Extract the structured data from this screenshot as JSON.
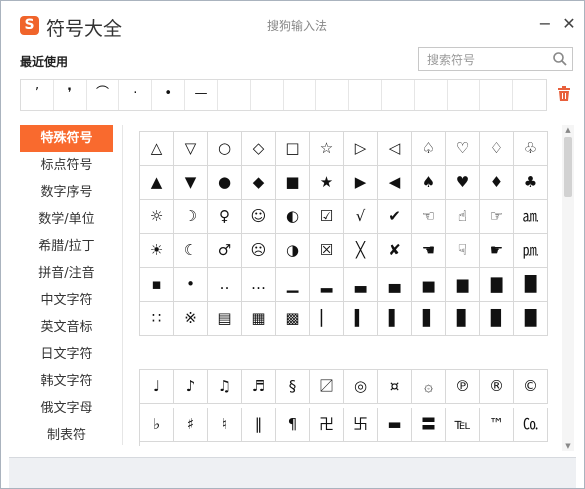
{
  "titlebar": {
    "logo_glyph": "S",
    "app_title": "符号大全",
    "window_title": "搜狗输入法",
    "minimize_glyph": "−",
    "close_glyph": "✕"
  },
  "recent_label": "最近使用",
  "search": {
    "placeholder": "搜索符号"
  },
  "recent_symbols": [
    "’",
    "❜",
    "⌒",
    "·",
    "•",
    "—",
    "",
    "",
    "",
    "",
    "",
    "",
    "",
    "",
    "",
    ""
  ],
  "sidebar": {
    "active_index": 0,
    "items": [
      "特殊符号",
      "标点符号",
      "数字序号",
      "数学/单位",
      "希腊/拉丁",
      "拼音/注音",
      "中文字符",
      "英文音标",
      "日文字符",
      "韩文字符",
      "俄文字母",
      "制表符"
    ]
  },
  "special_symbols": [
    "△",
    "▽",
    "○",
    "◇",
    "□",
    "☆",
    "▷",
    "◁",
    "♤",
    "♡",
    "♢",
    "♧",
    "▲",
    "▼",
    "●",
    "◆",
    "■",
    "★",
    "▶",
    "◀",
    "♠",
    "♥",
    "♦",
    "♣",
    "☼",
    "☽",
    "♀",
    "☺",
    "◐",
    "☑",
    "√",
    "✔",
    "☜",
    "☝",
    "☞",
    "㏂",
    "☀",
    "☾",
    "♂",
    "☹",
    "◑",
    "☒",
    "╳",
    "✘",
    "☚",
    "☟",
    "☛",
    "㏘",
    "▪",
    "•",
    "‥",
    "…",
    "▁",
    "▂",
    "▃",
    "▄",
    "▅",
    "▆",
    "▇",
    "█",
    "∷",
    "※",
    "▤",
    "▦",
    "▩",
    "▏",
    "▍",
    "▌",
    "▋",
    "▊",
    "▉",
    "█"
  ],
  "more_symbols": [
    "♩",
    "♪",
    "♫",
    "♬",
    "§",
    "〼",
    "◎",
    "¤",
    "۞",
    "℗",
    "®",
    "©",
    "♭",
    "♯",
    "♮",
    "‖",
    "¶",
    "卍",
    "卐",
    "▬",
    "〓",
    "℡",
    "™",
    "㏇"
  ],
  "colors": {
    "accent": "#f96a2e",
    "logo": "#f0642b",
    "trash": "#e8603c"
  }
}
